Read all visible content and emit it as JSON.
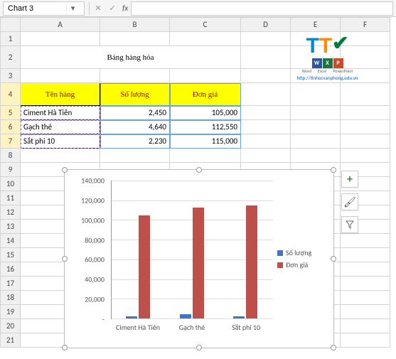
{
  "namebox": {
    "value": "Chart 3"
  },
  "columns": [
    "A",
    "B",
    "C",
    "D",
    "E",
    "F"
  ],
  "title": "Bảng hàng hóa",
  "headers": {
    "a": "Tên hàng",
    "b": "Số lượng",
    "c": "Đơn giá"
  },
  "rows": [
    {
      "name": "Ciment Hà Tiên",
      "qty": "2,450",
      "price": "105,000"
    },
    {
      "name": "Gạch thẻ",
      "qty": "4,640",
      "price": "112,550"
    },
    {
      "name": "Sắt phi 10",
      "qty": "2,230",
      "price": "115,000"
    }
  ],
  "logo": {
    "t1": "T",
    "t2": "T",
    "check": "✔",
    "icons": [
      "W",
      "X",
      "P"
    ],
    "labels": [
      "Word",
      "Excel",
      "PowerPoint"
    ],
    "url": "http://tinhocvanphong.edu.vn"
  },
  "chart_data": {
    "type": "bar",
    "categories": [
      "Ciment Hà Tiên",
      "Gạch thẻ",
      "Sắt phi 10"
    ],
    "series": [
      {
        "name": "Số lượng",
        "values": [
          2450,
          4640,
          2230
        ],
        "color": "#4472c4"
      },
      {
        "name": "Đơn giá",
        "values": [
          105000,
          112550,
          115000
        ],
        "color": "#bd504a"
      }
    ],
    "ylim": [
      0,
      140000
    ],
    "yticks": [
      0,
      20000,
      40000,
      60000,
      80000,
      100000,
      120000,
      140000
    ],
    "ytick_labels": [
      "-",
      "20,000",
      "40,000",
      "60,000",
      "80,000",
      "100,000",
      "120,000",
      "140,000"
    ]
  },
  "sidetools": {
    "plus": "+",
    "brush": "🖌",
    "filter": "▾"
  }
}
